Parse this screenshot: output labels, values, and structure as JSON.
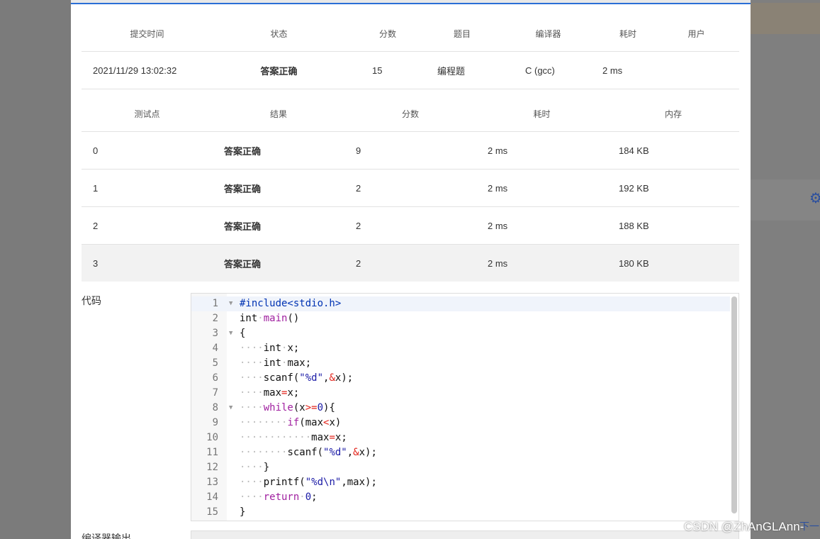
{
  "submission_table": {
    "headers": [
      "提交时间",
      "状态",
      "分数",
      "题目",
      "编译器",
      "耗时",
      "用户"
    ],
    "row": {
      "time": "2021/11/29 13:02:32",
      "status": "答案正确",
      "score": "15",
      "problem": "编程题",
      "compiler": "C (gcc)",
      "elapsed": "2 ms",
      "user": ""
    }
  },
  "testcase_table": {
    "headers": [
      "测试点",
      "结果",
      "分数",
      "耗时",
      "内存"
    ],
    "rows": [
      {
        "id": "0",
        "result": "答案正确",
        "score": "9",
        "time": "2 ms",
        "memory": "184 KB"
      },
      {
        "id": "1",
        "result": "答案正确",
        "score": "2",
        "time": "2 ms",
        "memory": "192 KB"
      },
      {
        "id": "2",
        "result": "答案正确",
        "score": "2",
        "time": "2 ms",
        "memory": "188 KB"
      },
      {
        "id": "3",
        "result": "答案正确",
        "score": "2",
        "time": "2 ms",
        "memory": "180 KB"
      }
    ]
  },
  "code_section": {
    "label": "代码",
    "lines": [
      "#include<stdio.h>",
      "int main()",
      "{",
      "    int x;",
      "    int max;",
      "    scanf(\"%d\",&x);",
      "    max=x;",
      "    while(x>=0){",
      "        if(max<x)",
      "            max=x;",
      "        scanf(\"%d\",&x);",
      "    }",
      "    printf(\"%d\\n\",max);",
      "    return 0;",
      "}"
    ],
    "fold_lines": [
      1,
      3,
      8
    ]
  },
  "compiler_output": {
    "label": "编译器输出"
  },
  "background": {
    "next_label": "下一",
    "gear_icon": "gear-icon"
  },
  "watermark": "CSDN @ZhAnGLAnn-",
  "colors": {
    "accent": "#2a6fd6",
    "success": "#e2231a"
  }
}
